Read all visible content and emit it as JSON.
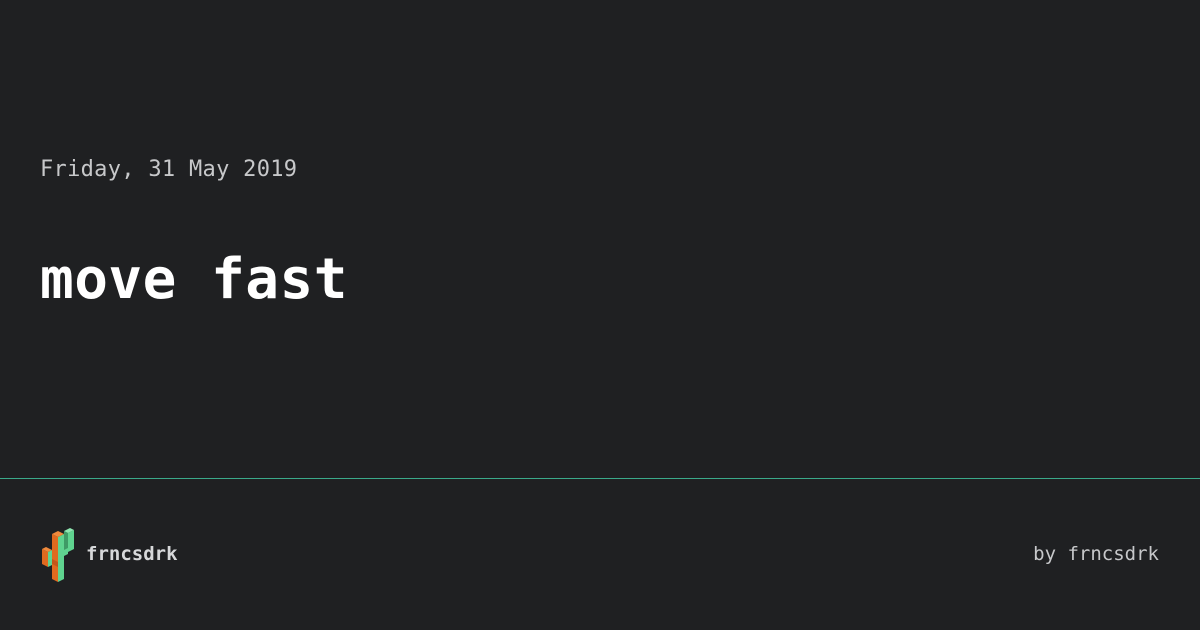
{
  "post": {
    "date": "Friday, 31 May 2019",
    "title": "move fast"
  },
  "footer": {
    "brand_name": "frncsdrk",
    "byline": "by frncsdrk",
    "logo_icon": "cactus-logo-icon"
  },
  "colors": {
    "background": "#1f2022",
    "divider": "#3aa98a",
    "logo_green": "#5fd38f",
    "logo_orange": "#e06a1f"
  }
}
